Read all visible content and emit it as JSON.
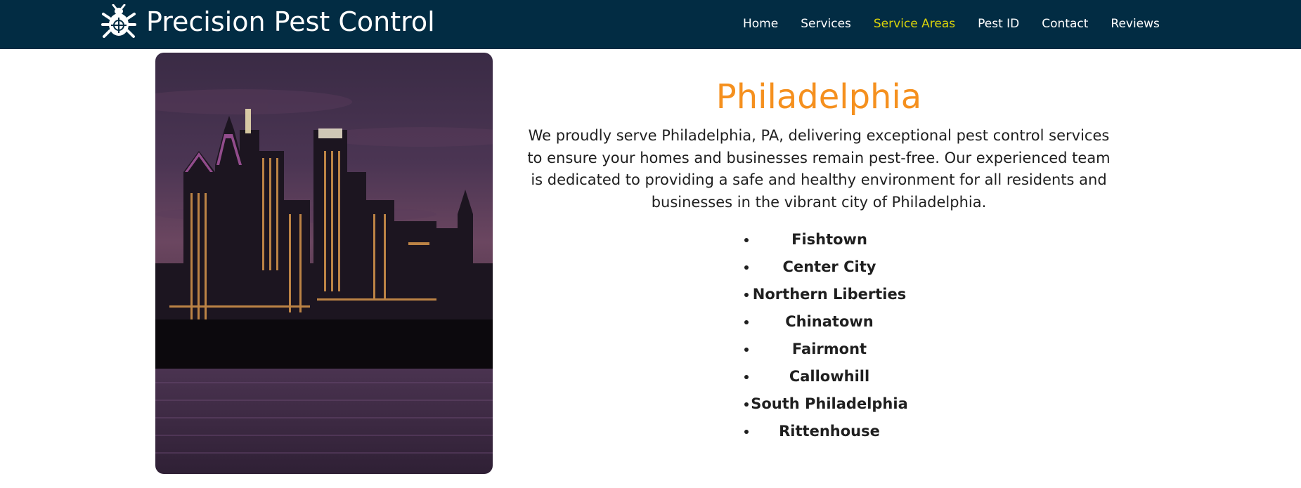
{
  "header": {
    "brand_name": "Precision Pest Control",
    "brand_icon": "bug-target-icon",
    "nav_items": [
      {
        "label": "Home",
        "active": false
      },
      {
        "label": "Services",
        "active": false
      },
      {
        "label": "Service Areas",
        "active": true
      },
      {
        "label": "Pest ID",
        "active": false
      },
      {
        "label": "Contact",
        "active": false
      },
      {
        "label": "Reviews",
        "active": false
      }
    ]
  },
  "main": {
    "photo_icon": "city-skyline-image",
    "title": "Philadelphia",
    "description": "We proudly serve Philadelphia, PA, delivering exceptional pest control services to ensure your homes and businesses remain pest-free. Our experienced team is dedicated to providing a safe and healthy environment for all residents and businesses in the vibrant city of Philadelphia.",
    "areas": [
      "Fishtown",
      "Center City",
      "Northern Liberties",
      "Chinatown",
      "Fairmont",
      "Callowhill",
      "South Philadelphia",
      "Rittenhouse"
    ]
  },
  "colors": {
    "navbar": "#022c43",
    "nav_active": "#d8d20a",
    "accent_title": "#f5901e",
    "text": "#1f1f1f"
  }
}
